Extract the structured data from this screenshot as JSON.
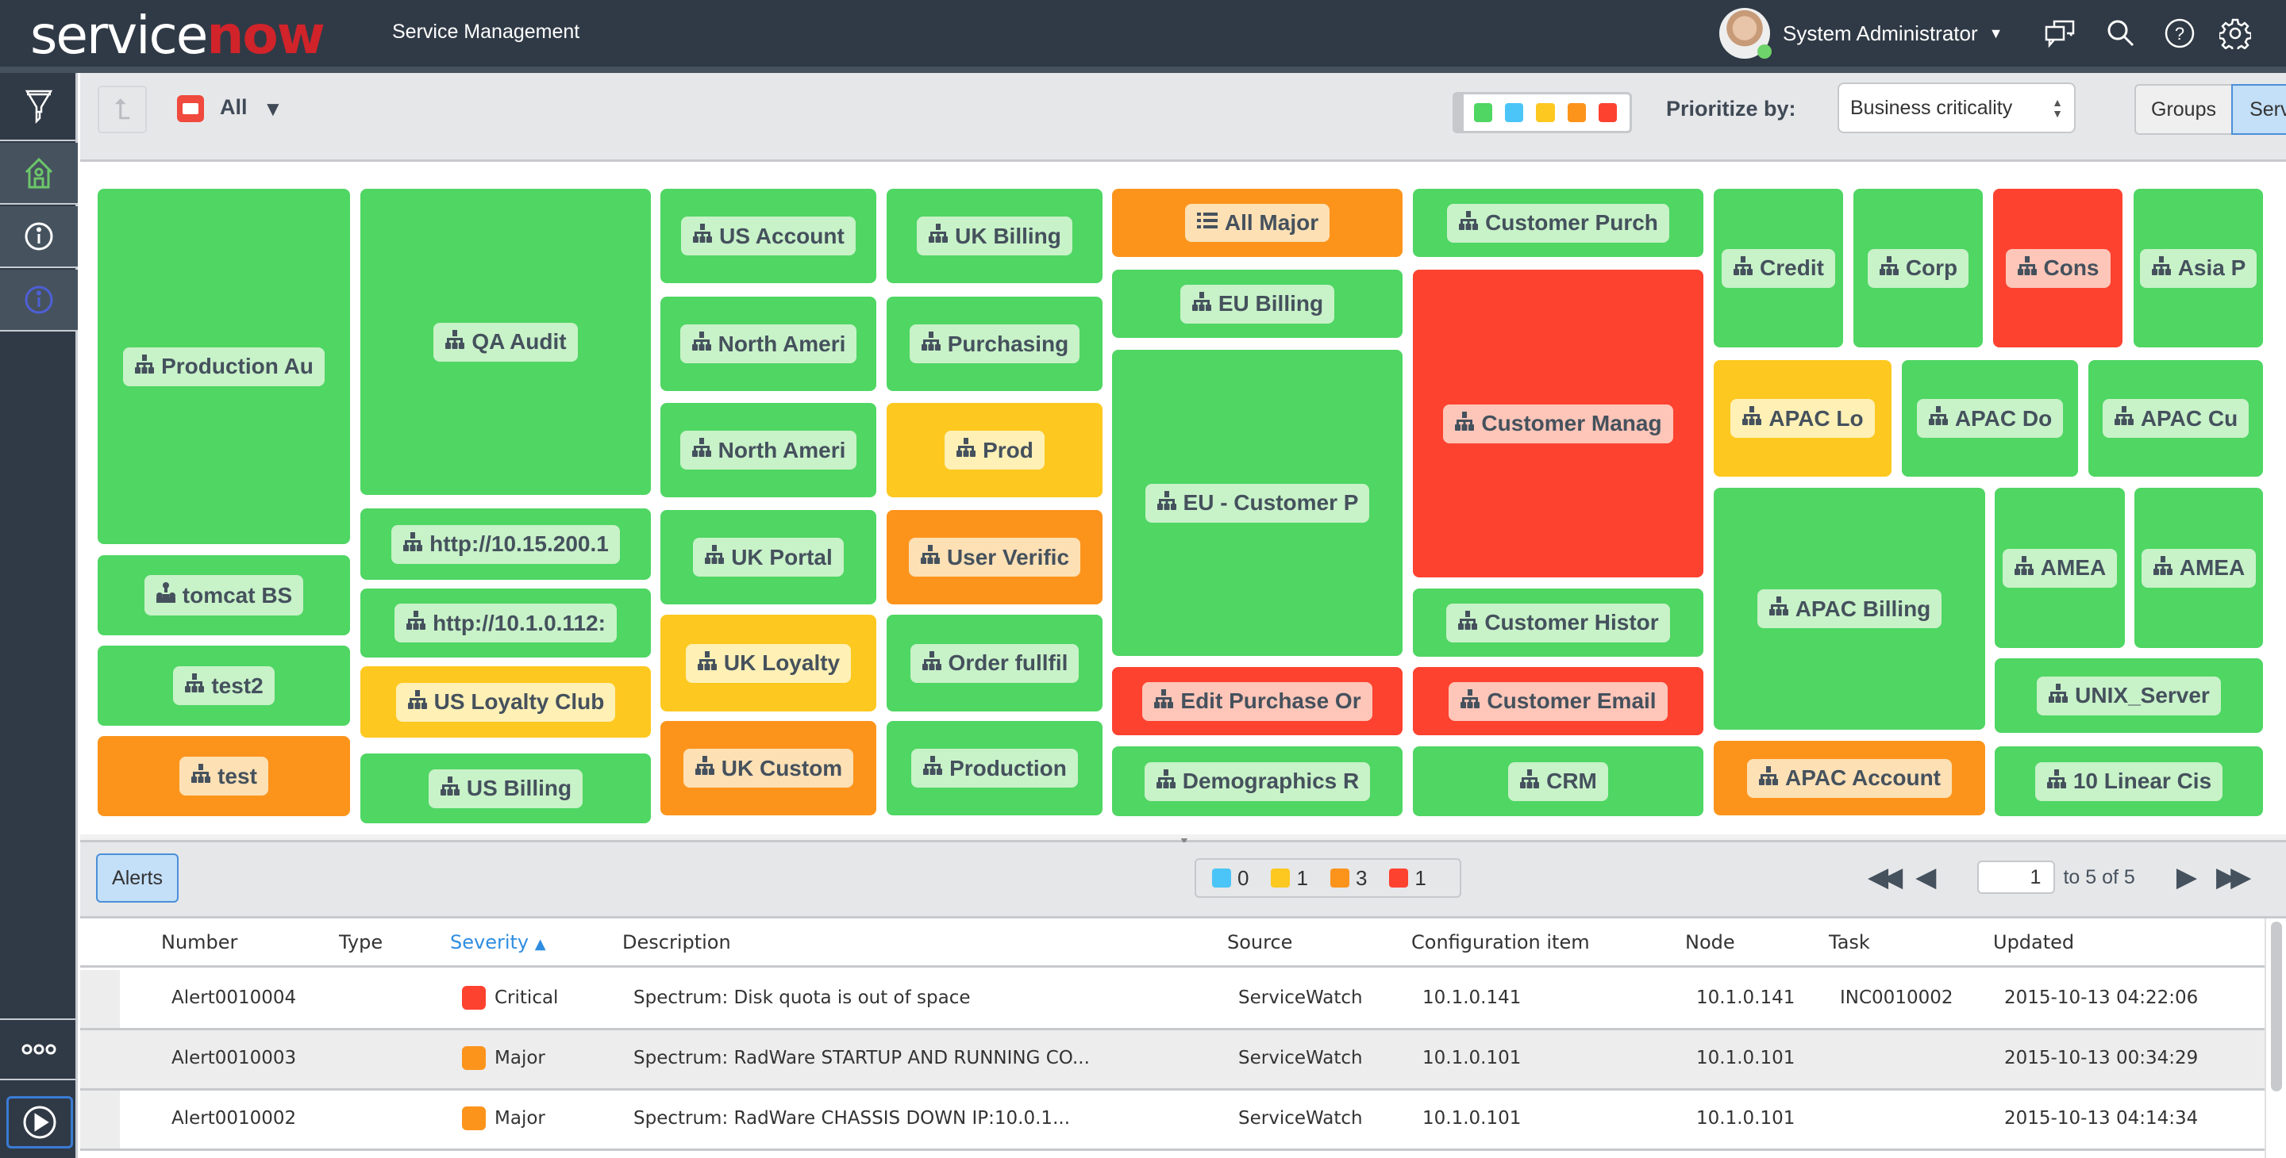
{
  "header": {
    "logo_white": "service",
    "logo_red": "now",
    "app_title": "Service Management",
    "user_name": "System Administrator",
    "icons": [
      "connect-chat-icon",
      "search-icon",
      "help-icon",
      "settings-gear-icon"
    ]
  },
  "sidenav": {
    "items": [
      {
        "name": "filter-icon"
      },
      {
        "name": "home-icon",
        "active": true
      },
      {
        "name": "info-icon",
        "active": true
      },
      {
        "name": "info-blue-icon",
        "active": true
      }
    ],
    "more_icon": "more-dots-icon",
    "play_icon": "play-icon"
  },
  "toolbar": {
    "folder_label": "All",
    "filter_colors": [
      "#4fd663",
      "#4bc5f7",
      "#fdc820",
      "#fc941c",
      "#fd4230"
    ],
    "prioritize_label": "Prioritize by:",
    "prioritize_value": "Business criticality",
    "view_groups": "Groups",
    "view_services": "Services",
    "view_selected": "Services"
  },
  "colors": {
    "ok": "#4fd663",
    "info": "#4bc5f7",
    "minor": "#fdc820",
    "major": "#fc941c",
    "critical": "#fd4230"
  },
  "treemap": {
    "tiles": [
      {
        "label": "Production Au",
        "status": "ok",
        "icon": "service-map"
      },
      {
        "label": "tomcat BS",
        "status": "ok",
        "icon": "service-cluster"
      },
      {
        "label": "test2",
        "status": "ok",
        "icon": "service-map"
      },
      {
        "label": "test",
        "status": "major",
        "icon": "service-map"
      },
      {
        "label": "QA Audit",
        "status": "ok",
        "icon": "service-map"
      },
      {
        "label": "http://10.15.200.1",
        "status": "ok",
        "icon": "service-map"
      },
      {
        "label": "http://10.1.0.112:",
        "status": "ok",
        "icon": "service-map"
      },
      {
        "label": "US Loyalty Club",
        "status": "minor",
        "icon": "service-map"
      },
      {
        "label": "US Billing",
        "status": "ok",
        "icon": "service-map"
      },
      {
        "label": "US Account",
        "status": "ok",
        "icon": "service-map"
      },
      {
        "label": "North Ameri",
        "status": "ok",
        "icon": "service-map"
      },
      {
        "label": "North Ameri",
        "status": "ok",
        "icon": "service-map"
      },
      {
        "label": "UK Portal",
        "status": "ok",
        "icon": "service-map"
      },
      {
        "label": "UK Loyalty",
        "status": "minor",
        "icon": "service-map"
      },
      {
        "label": "UK Custom",
        "status": "major",
        "icon": "service-map"
      },
      {
        "label": "UK Billing",
        "status": "ok",
        "icon": "service-map"
      },
      {
        "label": "Purchasing",
        "status": "ok",
        "icon": "service-map"
      },
      {
        "label": "Prod",
        "status": "minor",
        "icon": "service-map"
      },
      {
        "label": "User Verific",
        "status": "major",
        "icon": "service-map"
      },
      {
        "label": "Order fullfil",
        "status": "ok",
        "icon": "service-map"
      },
      {
        "label": "Production",
        "status": "ok",
        "icon": "service-map"
      },
      {
        "label": "All Major",
        "status": "major",
        "icon": "list"
      },
      {
        "label": "EU Billing",
        "status": "ok",
        "icon": "service-map"
      },
      {
        "label": "EU - Customer P",
        "status": "ok",
        "icon": "service-map"
      },
      {
        "label": "Edit Purchase Or",
        "status": "critical",
        "icon": "service-map"
      },
      {
        "label": "Demographics R",
        "status": "ok",
        "icon": "service-map"
      },
      {
        "label": "Customer Purch",
        "status": "ok",
        "icon": "service-map"
      },
      {
        "label": "Customer Manag",
        "status": "critical",
        "icon": "service-map"
      },
      {
        "label": "Customer Histor",
        "status": "ok",
        "icon": "service-map"
      },
      {
        "label": "Customer Email",
        "status": "critical",
        "icon": "service-map"
      },
      {
        "label": "CRM",
        "status": "ok",
        "icon": "service-map"
      },
      {
        "label": "Credit",
        "status": "ok",
        "icon": "service-map"
      },
      {
        "label": "Corp",
        "status": "ok",
        "icon": "service-map"
      },
      {
        "label": "Cons",
        "status": "critical",
        "icon": "service-map"
      },
      {
        "label": "Asia P",
        "status": "ok",
        "icon": "service-map"
      },
      {
        "label": "APAC Lo",
        "status": "minor",
        "icon": "service-map"
      },
      {
        "label": "APAC Do",
        "status": "ok",
        "icon": "service-map"
      },
      {
        "label": "APAC Cu",
        "status": "ok",
        "icon": "service-map"
      },
      {
        "label": "APAC Billing",
        "status": "ok",
        "icon": "service-map"
      },
      {
        "label": "APAC Account",
        "status": "major",
        "icon": "service-map"
      },
      {
        "label": "AMEA",
        "status": "ok",
        "icon": "service-map"
      },
      {
        "label": "AMEA",
        "status": "ok",
        "icon": "service-map"
      },
      {
        "label": "UNIX_Server",
        "status": "ok",
        "icon": "service-map"
      },
      {
        "label": "10 Linear Cis",
        "status": "ok",
        "icon": "service-map"
      }
    ]
  },
  "alerts": {
    "tab_label": "Alerts",
    "severity_counts": [
      {
        "color": "#4bc5f7",
        "count": "0"
      },
      {
        "color": "#fdc820",
        "count": "1"
      },
      {
        "color": "#fc941c",
        "count": "3"
      },
      {
        "color": "#fd4230",
        "count": "1"
      }
    ],
    "pager": {
      "current": "1",
      "range_text": "to 5 of 5"
    },
    "columns": [
      "Number",
      "Type",
      "Severity",
      "Description",
      "Source",
      "Configuration item",
      "Node",
      "Task",
      "Updated"
    ],
    "sorted_column": "Severity",
    "sort_direction": "ascending",
    "rows": [
      {
        "number": "Alert0010004",
        "type": "",
        "severity": "Critical",
        "severity_color": "#fd4230",
        "description": "Spectrum: Disk quota is out of space",
        "source": "ServiceWatch",
        "ci": "10.1.0.141",
        "node": "10.1.0.141",
        "task": "INC0010002",
        "updated": "2015-10-13 04:22:06"
      },
      {
        "number": "Alert0010003",
        "type": "",
        "severity": "Major",
        "severity_color": "#fc941c",
        "description": "Spectrum: RadWare STARTUP AND RUNNING CO...",
        "source": "ServiceWatch",
        "ci": "10.1.0.101",
        "node": "10.1.0.101",
        "task": "",
        "updated": "2015-10-13 00:34:29"
      },
      {
        "number": "Alert0010002",
        "type": "",
        "severity": "Major",
        "severity_color": "#fc941c",
        "description": "Spectrum: RadWare CHASSIS DOWN IP:10.0.1...",
        "source": "ServiceWatch",
        "ci": "10.1.0.101",
        "node": "10.1.0.101",
        "task": "",
        "updated": "2015-10-13 04:14:34"
      }
    ]
  }
}
